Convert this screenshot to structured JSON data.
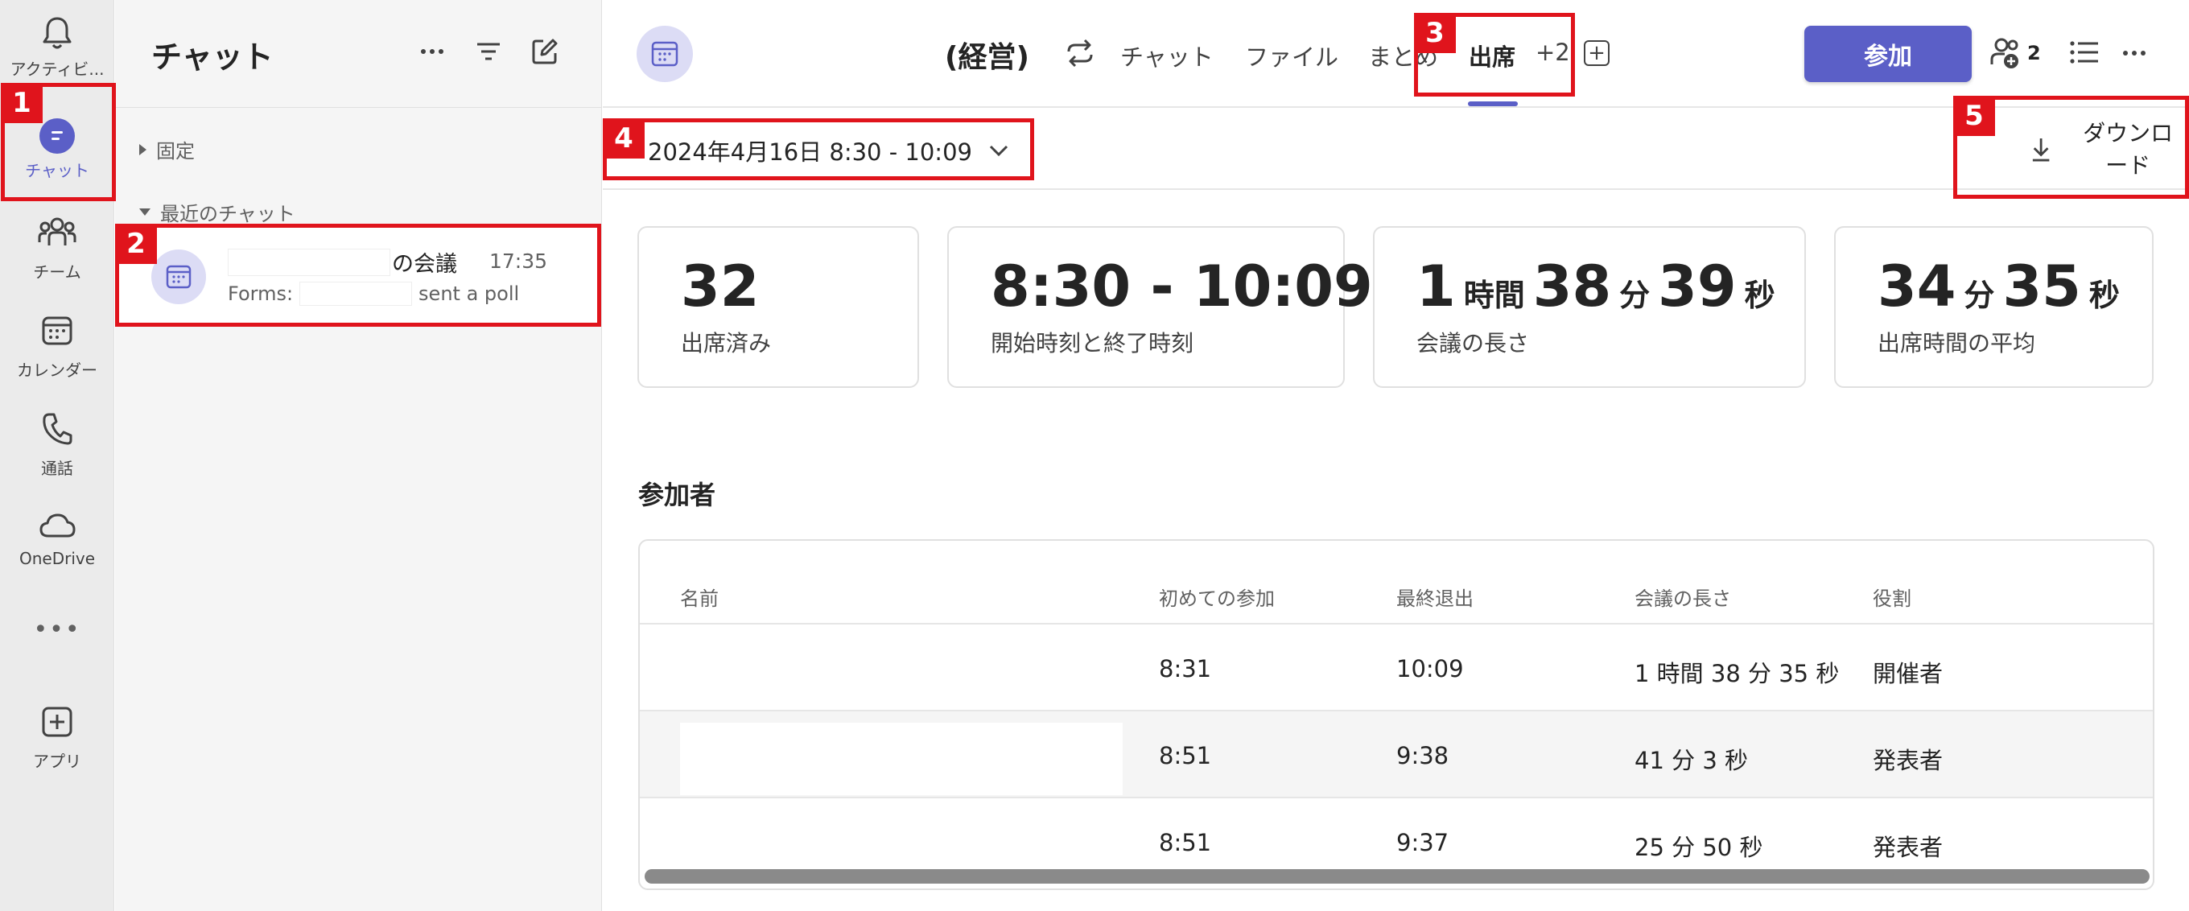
{
  "rail": {
    "items": [
      {
        "label": "アクティビ..."
      },
      {
        "label": "チャット"
      },
      {
        "label": "チーム"
      },
      {
        "label": "カレンダー"
      },
      {
        "label": "通話"
      },
      {
        "label": "OneDrive"
      },
      {
        "label": "アプリ"
      }
    ],
    "more": "•••"
  },
  "chat_pane": {
    "title": "チャット",
    "pinned_label": "固定",
    "recent_label": "最近のチャット",
    "chats": [
      {
        "title_suffix": "の会議",
        "time": "17:35",
        "preview_prefix": "Forms:",
        "preview_suffix": "sent a poll"
      }
    ]
  },
  "header": {
    "meeting_title": "(経営)",
    "tabs": [
      {
        "label": "チャット"
      },
      {
        "label": "ファイル"
      },
      {
        "label": "まとめ"
      },
      {
        "label": "出席"
      }
    ],
    "extra_tabs": "+2",
    "join_label": "参加",
    "participant_count": "2"
  },
  "attendance": {
    "date_range": "2024年4月16日 8:30 - 10:09",
    "download_label": "ダウンロード",
    "stats": [
      {
        "value": "32",
        "label": "出席済み"
      },
      {
        "value": "8:30 - 10:09",
        "label": "開始時刻と終了時刻"
      },
      {
        "value_parts": [
          "1",
          "時間",
          "38",
          "分",
          "39",
          "秒"
        ],
        "label": "会議の長さ"
      },
      {
        "value_parts": [
          "34",
          "分",
          "35",
          "秒"
        ],
        "label": "出席時間の平均"
      }
    ],
    "participants_title": "参加者",
    "columns": [
      "名前",
      "初めての参加",
      "最終退出",
      "会議の長さ",
      "役割"
    ],
    "rows": [
      {
        "first_join": "8:31",
        "last_leave": "10:09",
        "duration": "1 時間 38 分 35 秒",
        "role": "開催者"
      },
      {
        "first_join": "8:51",
        "last_leave": "9:38",
        "duration": "41 分 3 秒",
        "role": "発表者"
      },
      {
        "first_join": "8:51",
        "last_leave": "9:37",
        "duration": "25 分 50 秒",
        "role": "発表者"
      }
    ]
  },
  "callouts": [
    "1",
    "2",
    "3",
    "4",
    "5"
  ],
  "colors": {
    "accent": "#5b5fc7",
    "callout": "#e0141c"
  }
}
